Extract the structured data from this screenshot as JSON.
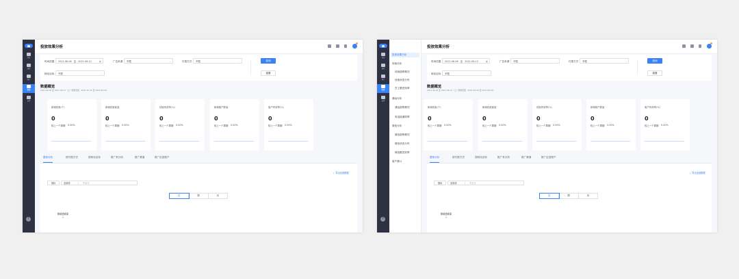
{
  "rail": {
    "items": [
      {
        "label": "首页",
        "icon": "home-icon"
      },
      {
        "label": "线索",
        "icon": "phone-icon"
      },
      {
        "label": "客户",
        "icon": "contacts-icon"
      },
      {
        "label": "数据",
        "icon": "chart-icon"
      },
      {
        "label": "设置",
        "icon": "gear-icon"
      }
    ],
    "help": "?"
  },
  "submenu": {
    "items": [
      {
        "label": "投放效果分析",
        "kind": "sel"
      },
      {
        "label": "线索分析",
        "kind": "grp"
      },
      {
        "label": "线索趋势概况",
        "kind": "sub"
      },
      {
        "label": "线索状态分布",
        "kind": "sub"
      },
      {
        "label": "员工跟进效率",
        "kind": "sub"
      },
      {
        "label": "通话分析",
        "kind": "grp"
      },
      {
        "label": "通话趋势概况",
        "kind": "sub"
      },
      {
        "label": "电话接通效率",
        "kind": "sub"
      },
      {
        "label": "微信分析",
        "kind": "grp"
      },
      {
        "label": "微信趋势概况",
        "kind": "sub"
      },
      {
        "label": "微信状态分布",
        "kind": "sub"
      },
      {
        "label": "微信跟进效率",
        "kind": "sub"
      },
      {
        "label": "客户漏斗",
        "kind": "top"
      }
    ]
  },
  "header": {
    "title": "投放效果分析"
  },
  "filters": {
    "time_label": "时间范围",
    "date_start": "2021-06-06",
    "date_sep": "至",
    "date_end": "2021-06-12",
    "source_label": "广告来源",
    "source_value": "不限",
    "pay_label": "付费方式",
    "pay_value": "不限",
    "product_label": "转化目标",
    "product_value": "不限",
    "query_button": "查询",
    "reset_button": "重置"
  },
  "overview": {
    "title": "数据概览",
    "subtitle": "2021-06-06 至 2021-06-12（上一周期范围：2021-05-30 至 2021-06-05）"
  },
  "cards": [
    {
      "title": "新增线索(个)",
      "value": "0",
      "compare_label": "较上一个周期",
      "percent": "0.00%"
    },
    {
      "title": "新增线索客量",
      "value": "0",
      "compare_label": "较上一个周期",
      "percent": "0.00%"
    },
    {
      "title": "线索有效率(%)",
      "value": "0",
      "compare_label": "较上一个周期",
      "percent": "0.00%"
    },
    {
      "title": "新增客户数量",
      "value": "0",
      "compare_label": "较上一个周期",
      "percent": "0.00%"
    },
    {
      "title": "客户有效率(%)",
      "value": "0",
      "compare_label": "较上一个周期",
      "percent": "0.00%"
    }
  ],
  "tabs": [
    "整体分析",
    "按付费方式",
    "按转化目标",
    "推广来分析",
    "推广渠道",
    "推广区县账户"
  ],
  "panel": {
    "export_label": "导出全部数据",
    "dimension_label": "指标",
    "cascade_first": "全部线",
    "cascade_sep": "/",
    "cascade_placeholder": "不太行",
    "granularity": [
      "日",
      "周",
      "月"
    ],
    "metric_title": "新增线索量",
    "metric_value": "1"
  },
  "colors": {
    "accent": "#3b82f6",
    "rail": "#2d3142",
    "page_bg": "#f5f7fb"
  }
}
